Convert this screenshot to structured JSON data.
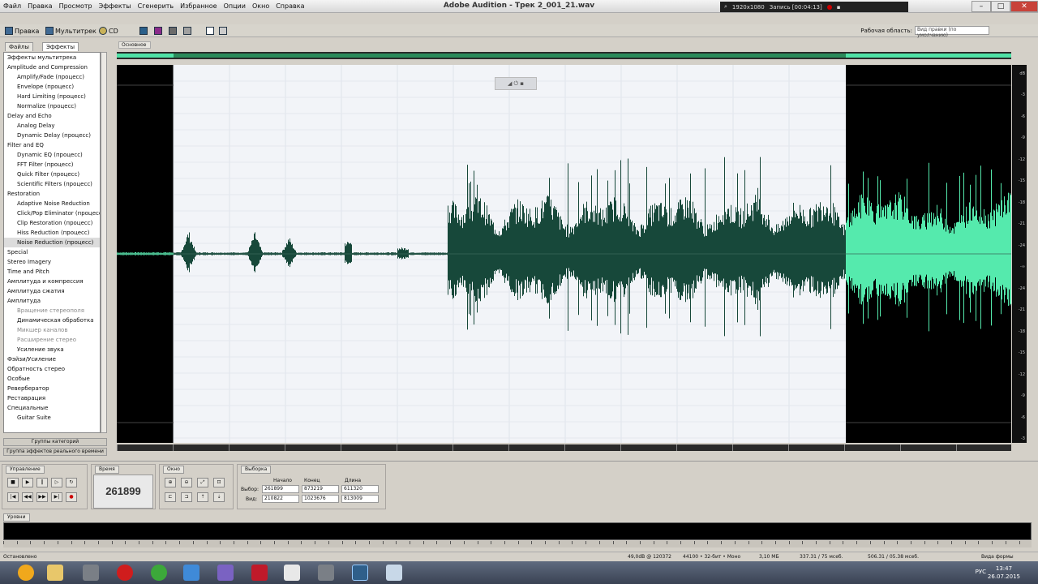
{
  "app": {
    "title": "Adobe Audition - Трек 2_001_21.wav"
  },
  "menu": [
    "Файл",
    "Правка",
    "Просмотр",
    "Эффекты",
    "Сгенерить",
    "Избранное",
    "Опции",
    "Окно",
    "Справка"
  ],
  "recorder": {
    "resolution": "1920x1080",
    "status": "Запись [00:04:13]"
  },
  "toolbar": {
    "edit_label": "Правка",
    "multitrack_label": "Мультитрек",
    "cd_label": "CD",
    "workspace_label": "Рабочая область:",
    "workspace_value": "Вид правки (по умолчанию)"
  },
  "left_panel": {
    "tabs": [
      "Файлы",
      "Эффекты"
    ],
    "effects": [
      {
        "label": "Эффекты мультитрека",
        "level": 1
      },
      {
        "label": "Amplitude and Compression",
        "level": 1
      },
      {
        "label": "Amplify/Fade (процесс)",
        "level": 2
      },
      {
        "label": "Envelope (процесс)",
        "level": 2
      },
      {
        "label": "Hard Limiting (процесс)",
        "level": 2
      },
      {
        "label": "Normalize (процесс)",
        "level": 2
      },
      {
        "label": "Delay and Echo",
        "level": 1
      },
      {
        "label": "Analog Delay",
        "level": 2
      },
      {
        "label": "Dynamic Delay (процесс)",
        "level": 2
      },
      {
        "label": "Filter and EQ",
        "level": 1
      },
      {
        "label": "Dynamic EQ (процесс)",
        "level": 2
      },
      {
        "label": "FFT Filter (процесс)",
        "level": 2
      },
      {
        "label": "Quick Filter (процесс)",
        "level": 2
      },
      {
        "label": "Scientific Filters (процесс)",
        "level": 2
      },
      {
        "label": "Restoration",
        "level": 1
      },
      {
        "label": "Adaptive Noise Reduction",
        "level": 2
      },
      {
        "label": "Click/Pop Eliminator (процесс)",
        "level": 2
      },
      {
        "label": "Clip Restoration (процесс)",
        "level": 2
      },
      {
        "label": "Hiss Reduction (процесс)",
        "level": 2
      },
      {
        "label": "Noise Reduction (процесс)",
        "level": 2,
        "selected": true
      },
      {
        "label": "Special",
        "level": 1
      },
      {
        "label": "Stereo Imagery",
        "level": 1
      },
      {
        "label": "Time and Pitch",
        "level": 1
      },
      {
        "label": "Амплитуда и компрессия",
        "level": 1
      },
      {
        "label": "Амплитуда сжатия",
        "level": 1
      },
      {
        "label": "Амплитуда",
        "level": 1
      },
      {
        "label": "Вращение стереополя",
        "level": 2,
        "grey": true
      },
      {
        "label": "Динамическая обработка",
        "level": 2
      },
      {
        "label": "Микшер каналов",
        "level": 2,
        "grey": true
      },
      {
        "label": "Расширение стерео",
        "level": 2,
        "grey": true
      },
      {
        "label": "Усиление звука",
        "level": 2
      },
      {
        "label": "Фэйзи/Усиление",
        "level": 1
      },
      {
        "label": "Обратность стерео",
        "level": 1
      },
      {
        "label": "Особые",
        "level": 1
      },
      {
        "label": "Ревербератор",
        "level": 1
      },
      {
        "label": "Реставрация",
        "level": 1
      },
      {
        "label": "Специальные",
        "level": 1
      },
      {
        "label": "Guitar Suite",
        "level": 2
      }
    ],
    "group_btn1": "Группы категорий",
    "group_btn2": "Группа эффектов реального времени"
  },
  "wave": {
    "tab": "Основное",
    "hover_ctl": "◢ ⏻ ▪"
  },
  "db_scale": [
    "dB",
    "-3",
    "-6",
    "-9",
    "-12",
    "-15",
    "-18",
    "-21",
    "-24",
    "-∞",
    "-24",
    "-21",
    "-18",
    "-15",
    "-12",
    "-9",
    "-6",
    "-3"
  ],
  "transport": {
    "label": "Управление"
  },
  "time": {
    "label": "Время",
    "value": "261899"
  },
  "zoom": {
    "label": "Окно"
  },
  "selection": {
    "label": "Выборка",
    "col_start": "Начало",
    "col_end": "Конец",
    "col_length": "Длина",
    "row_sel": "Выбор:",
    "row_view": "Вид:",
    "sel_start": "261899",
    "sel_end": "873219",
    "sel_length": "611320",
    "view_start": "210822",
    "view_end": "1023676",
    "view_length": "813009"
  },
  "levels": {
    "label": "Уровни"
  },
  "status": {
    "left": "Остановлено",
    "s1": "49,0dB @ 120372",
    "s2": "44100 • 32-бит • Моно",
    "s3": "3,10 МБ",
    "s4": "337.31 / 75 мсеб.",
    "s5": "506.31 / 05.38 мсеб.",
    "right": "Вида формы"
  },
  "taskbar": {
    "lang": "РУС",
    "time": "13:47",
    "date": "26.07.2015"
  },
  "colors": {
    "wave_selected": "#17483a",
    "wave_unselected": "#55eaad",
    "selection_bg": "#f2f4f8"
  }
}
